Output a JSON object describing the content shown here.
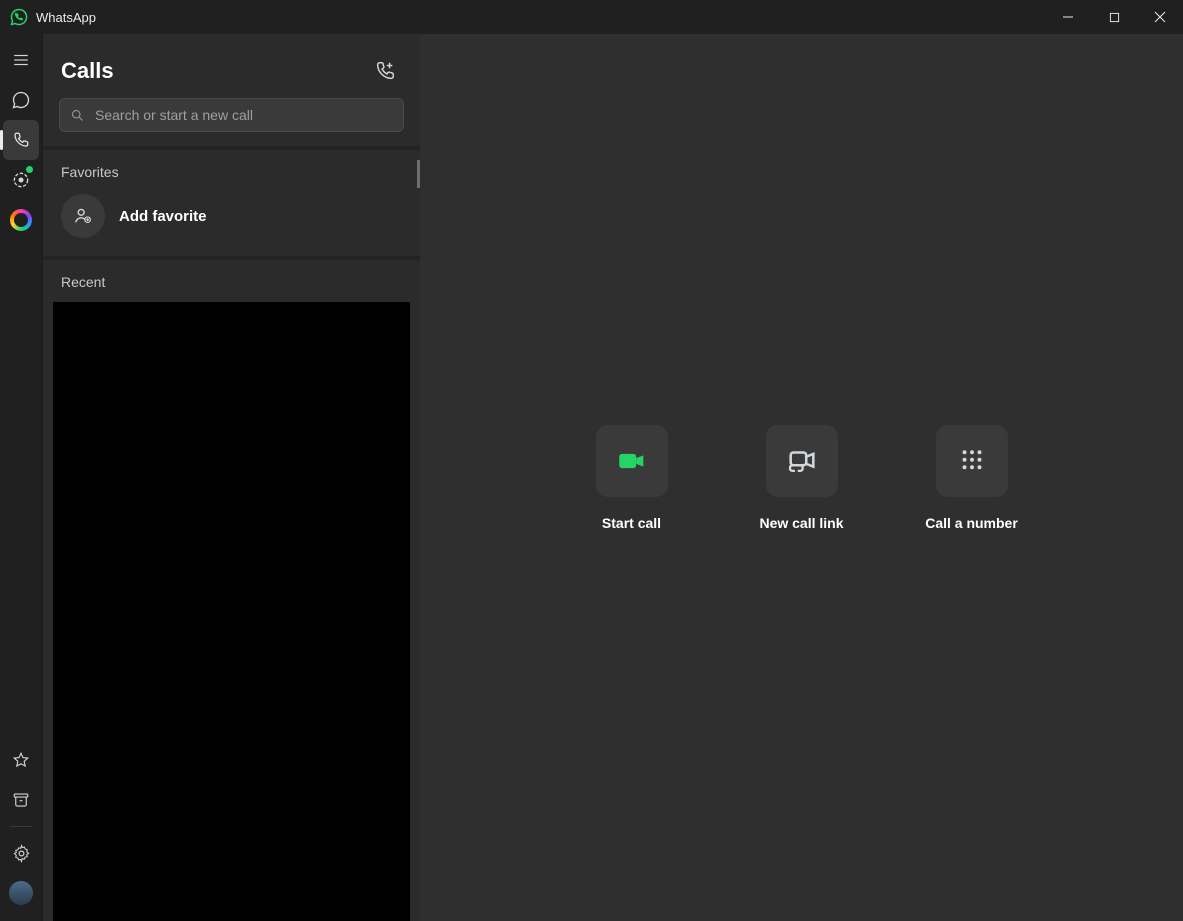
{
  "titlebar": {
    "app_name": "WhatsApp"
  },
  "nav": {
    "items": [
      {
        "name": "menu"
      },
      {
        "name": "chats"
      },
      {
        "name": "calls",
        "active": true
      },
      {
        "name": "status"
      },
      {
        "name": "meta-ai"
      }
    ],
    "bottom": [
      {
        "name": "starred"
      },
      {
        "name": "archive"
      },
      {
        "name": "settings"
      },
      {
        "name": "profile"
      }
    ]
  },
  "calls": {
    "title": "Calls",
    "search_placeholder": "Search or start a new call",
    "favorites_label": "Favorites",
    "add_favorite_label": "Add favorite",
    "recent_label": "Recent"
  },
  "content": {
    "actions": {
      "start_call": "Start call",
      "new_call_link": "New call link",
      "call_number": "Call a number"
    }
  }
}
